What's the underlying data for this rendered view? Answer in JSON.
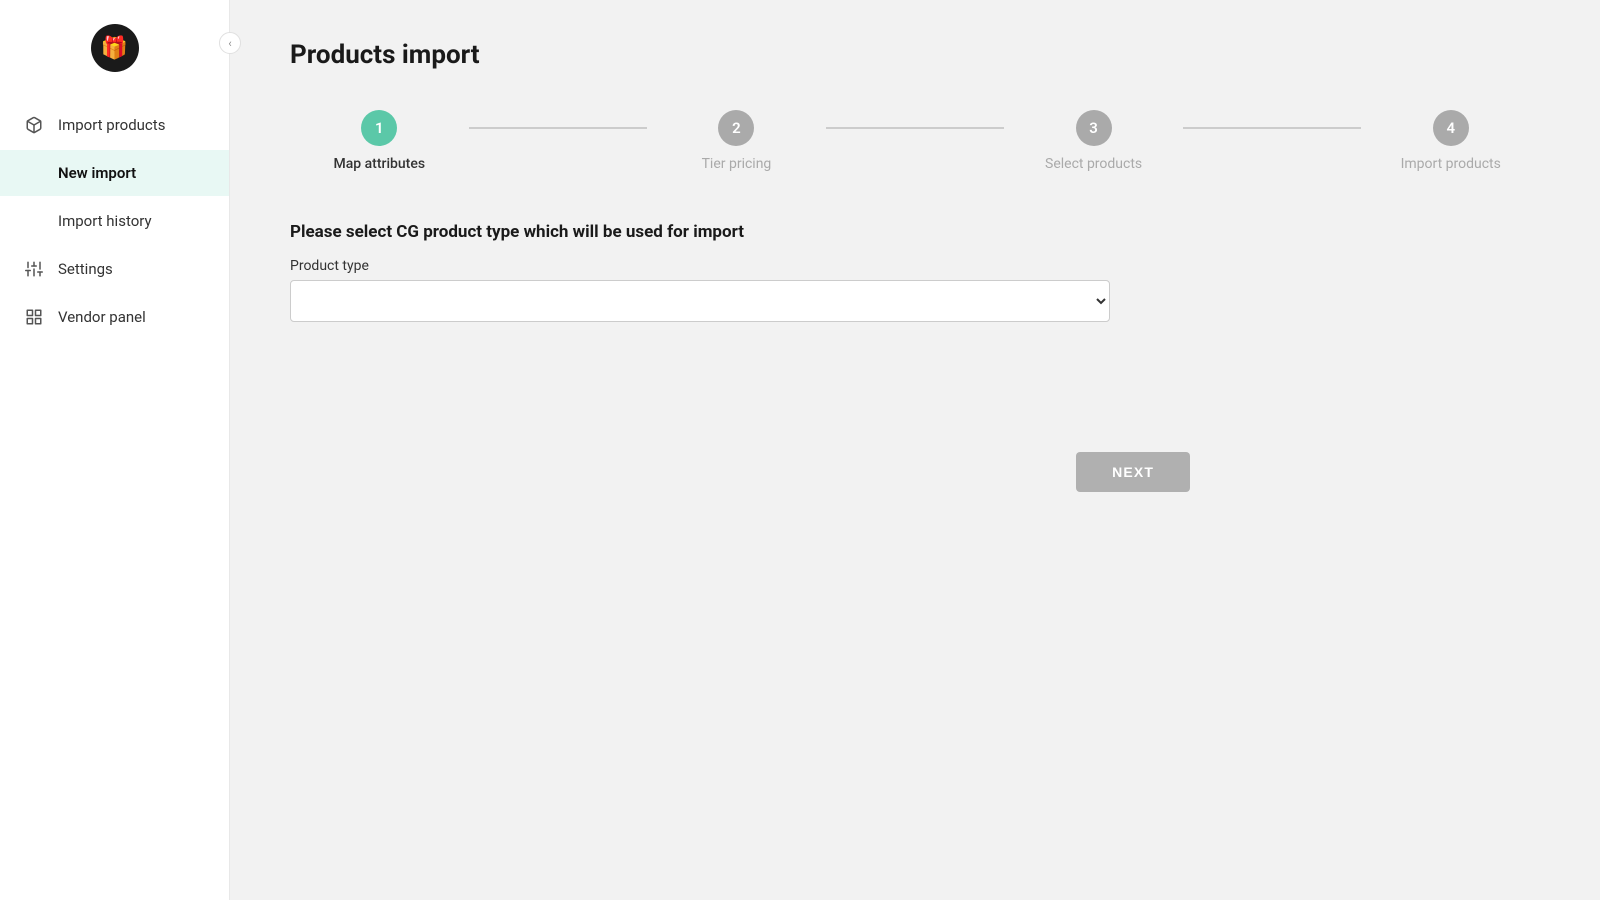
{
  "sidebar": {
    "logo_icon": "🎁",
    "collapse_icon": "‹",
    "nav_items": [
      {
        "id": "import-products",
        "label": "Import products",
        "icon": "package",
        "active": false
      },
      {
        "id": "new-import",
        "label": "New import",
        "icon": "none",
        "active": true
      },
      {
        "id": "import-history",
        "label": "Import history",
        "icon": "none",
        "active": false
      },
      {
        "id": "settings",
        "label": "Settings",
        "icon": "sliders",
        "active": false
      },
      {
        "id": "vendor-panel",
        "label": "Vendor panel",
        "icon": "grid",
        "active": false
      }
    ]
  },
  "main": {
    "page_title": "Products import",
    "stepper": {
      "steps": [
        {
          "id": "map-attributes",
          "number": "1",
          "label": "Map attributes",
          "state": "active"
        },
        {
          "id": "tier-pricing",
          "number": "2",
          "label": "Tier pricing",
          "state": "inactive"
        },
        {
          "id": "select-products",
          "number": "3",
          "label": "Select products",
          "state": "inactive"
        },
        {
          "id": "import-products",
          "number": "4",
          "label": "Import products",
          "state": "inactive"
        }
      ]
    },
    "form": {
      "heading": "Please select CG product type which will be used for import",
      "product_type_label": "Product type",
      "product_type_placeholder": ""
    },
    "next_button": "NEXT"
  }
}
